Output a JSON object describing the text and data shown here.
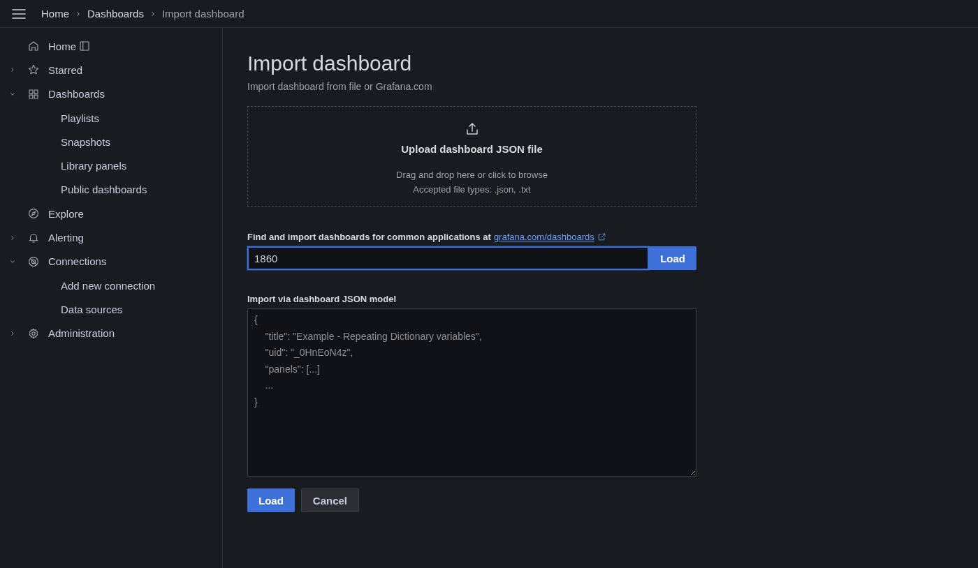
{
  "breadcrumbs": [
    {
      "label": "Home",
      "current": false
    },
    {
      "label": "Dashboards",
      "current": false
    },
    {
      "label": "Import dashboard",
      "current": true
    }
  ],
  "sidebar": {
    "items": [
      {
        "label": "Home"
      },
      {
        "label": "Starred",
        "expanded": false
      },
      {
        "label": "Dashboards",
        "expanded": true,
        "children": [
          {
            "label": "Playlists"
          },
          {
            "label": "Snapshots"
          },
          {
            "label": "Library panels"
          },
          {
            "label": "Public dashboards"
          }
        ]
      },
      {
        "label": "Explore"
      },
      {
        "label": "Alerting",
        "expanded": false
      },
      {
        "label": "Connections",
        "expanded": true,
        "children": [
          {
            "label": "Add new connection"
          },
          {
            "label": "Data sources"
          }
        ]
      },
      {
        "label": "Administration",
        "expanded": false
      }
    ]
  },
  "page": {
    "title": "Import dashboard",
    "subtitle": "Import dashboard from file or Grafana.com"
  },
  "upload": {
    "title": "Upload dashboard JSON file",
    "hint": "Drag and drop here or click to browse",
    "types": "Accepted file types: .json, .txt"
  },
  "grafana_com": {
    "label": "Find and import dashboards for common applications at",
    "link": "grafana.com/dashboards",
    "value": "1860",
    "focused": true,
    "button": "Load"
  },
  "json_model": {
    "label": "Import via dashboard JSON model",
    "placeholder": "{\n    \"title\": \"Example - Repeating Dictionary variables\",\n    \"uid\": \"_0HnEoN4z\",\n    \"panels\": [...]\n    ...\n}"
  },
  "buttons": [
    {
      "label": "Load",
      "kind": "primary"
    },
    {
      "label": "Cancel",
      "kind": "secondary"
    }
  ]
}
